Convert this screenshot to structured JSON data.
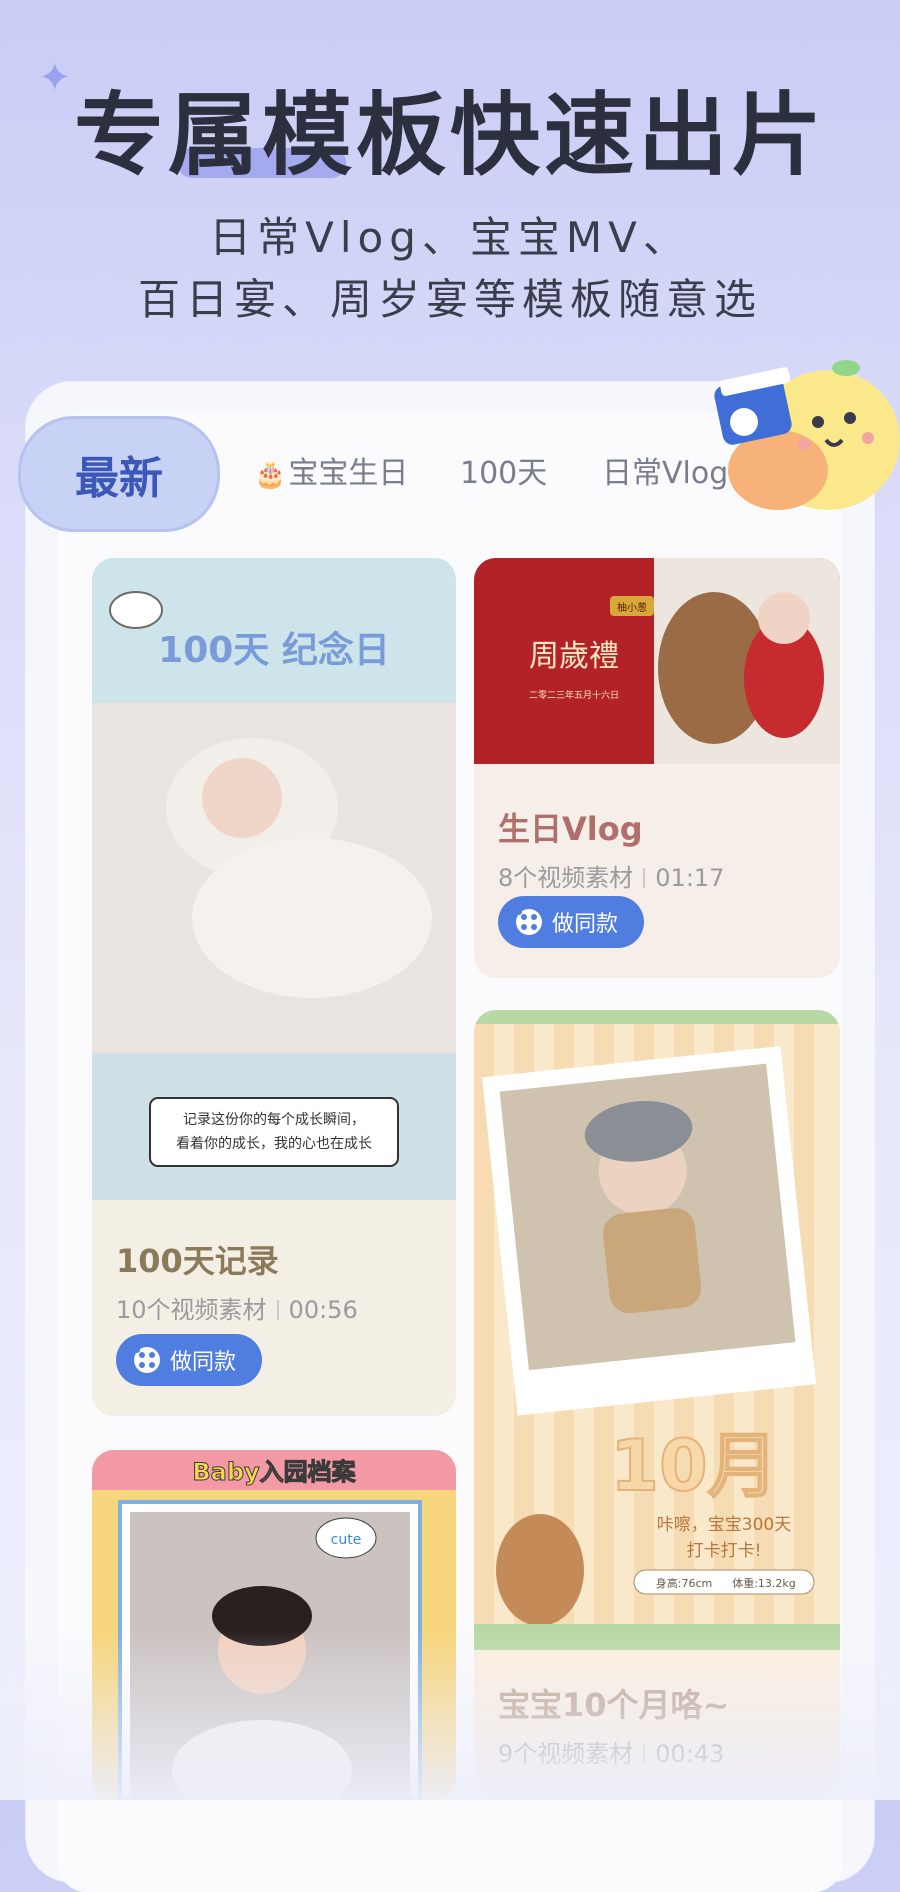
{
  "header": {
    "headline": "专属模板快速出片",
    "subline1": "日常Vlog、宝宝MV、",
    "subline2": "百日宴、周岁宴等模板随意选"
  },
  "tabs": [
    {
      "label": "最新",
      "active": true
    },
    {
      "label": "宝宝生日",
      "icon": "cake-icon"
    },
    {
      "label": "100天"
    },
    {
      "label": "日常Vlog"
    }
  ],
  "cards": [
    {
      "thumb_texts": [
        "100天 纪念日",
        "记录这份你的每个成长瞬间，",
        "看着你的成长，我的心也在成长"
      ],
      "title": "100天记录",
      "count": "10个视频素材",
      "duration": "00:56",
      "button": "做同款",
      "title_color": "#8a7a5a"
    },
    {
      "thumb_texts": [
        "周歲禮",
        "柚小葱",
        "二零二三年五月十六日"
      ],
      "title": "生日Vlog",
      "count": "8个视频素材",
      "duration": "01:17",
      "button": "做同款",
      "title_color": "#b06f6a"
    },
    {
      "thumb_texts": [
        "10月",
        "咔嚓，宝宝300天",
        "打卡打卡!",
        "身高:76cm",
        "体重:13.2kg"
      ],
      "title": "宝宝10个月咯~",
      "count": "9个视频素材",
      "duration": "00:43",
      "title_color": "#b9a08a"
    },
    {
      "thumb_texts": [
        "Baby入园档案",
        "cute"
      ]
    }
  ],
  "colors": {
    "accent": "#4f7de0",
    "tab_active_bg": "#c8d2f5"
  }
}
